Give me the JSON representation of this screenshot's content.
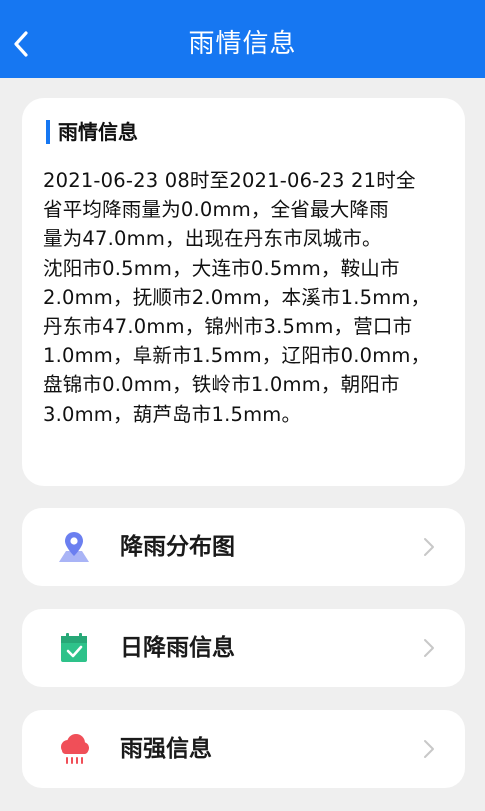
{
  "header": {
    "title": "雨情信息",
    "back_icon": "chevron-left-icon"
  },
  "info_card": {
    "title": "雨情信息",
    "lines": [
      "2021-06-23 08时至2021-06-23 21时全",
      "省平均降雨量为0.0mm，全省最大降雨",
      "量为47.0mm，出现在丹东市凤城市。",
      "沈阳市0.5mm，大连市0.5mm，鞍山市",
      "2.0mm，抚顺市2.0mm，本溪市1.5mm，",
      "丹东市47.0mm，锦州市3.5mm，营口市",
      "1.0mm，阜新市1.5mm，辽阳市0.0mm，",
      "盘锦市0.0mm，铁岭市1.0mm，朝阳市",
      "3.0mm，葫芦岛市1.5mm。"
    ]
  },
  "menu": [
    {
      "label": "降雨分布图",
      "icon": "map-pin-icon",
      "color": "#6b7ff0"
    },
    {
      "label": "日降雨信息",
      "icon": "calendar-check-icon",
      "color": "#2ec28a"
    },
    {
      "label": "雨强信息",
      "icon": "rain-cloud-icon",
      "color": "#f04f58"
    }
  ],
  "colors": {
    "accent": "#1677f2",
    "background": "#efefef",
    "card": "#ffffff"
  }
}
